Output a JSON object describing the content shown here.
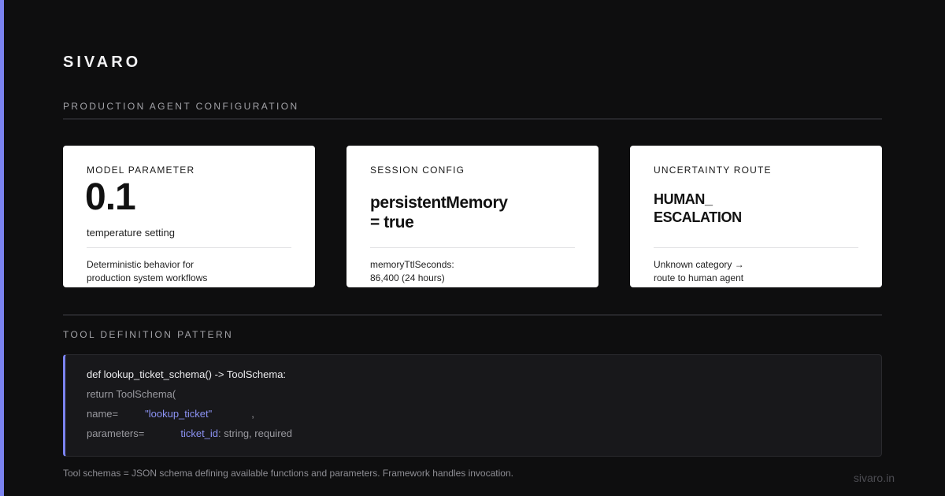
{
  "brand": "SIVARO",
  "sections": {
    "config_title": "PRODUCTION AGENT CONFIGURATION",
    "tool_title": "TOOL DEFINITION PATTERN"
  },
  "cards": [
    {
      "kicker": "MODEL PARAMETER",
      "value": "0.1",
      "subtitle": "temperature setting",
      "description": "Deterministic behavior for\nproduction system workflows"
    },
    {
      "kicker": "SESSION CONFIG",
      "value": "persistentMemory\n= true",
      "description": "memoryTtlSeconds:\n86,400 (24 hours)"
    },
    {
      "kicker": "UNCERTAINTY ROUTE",
      "value": "HUMAN_\nESCALATION",
      "description": "Unknown category →\nroute to human agent"
    }
  ],
  "code": {
    "line1": "def lookup_ticket_schema() -> ToolSchema:",
    "line2": "return ToolSchema(",
    "line3_key": "name=",
    "line3_value": "\"lookup_ticket\"",
    "line3_tail": ",",
    "line4_key": "parameters=",
    "line4_param": "ticket_id",
    "line4_tail": ": string, required"
  },
  "footnote": "Tool schemas = JSON schema defining available functions and parameters. Framework handles invocation.",
  "site": "sivaro.in",
  "colors": {
    "accent": "#7b83f0",
    "background": "#0e0e0f",
    "card": "#ffffff"
  }
}
